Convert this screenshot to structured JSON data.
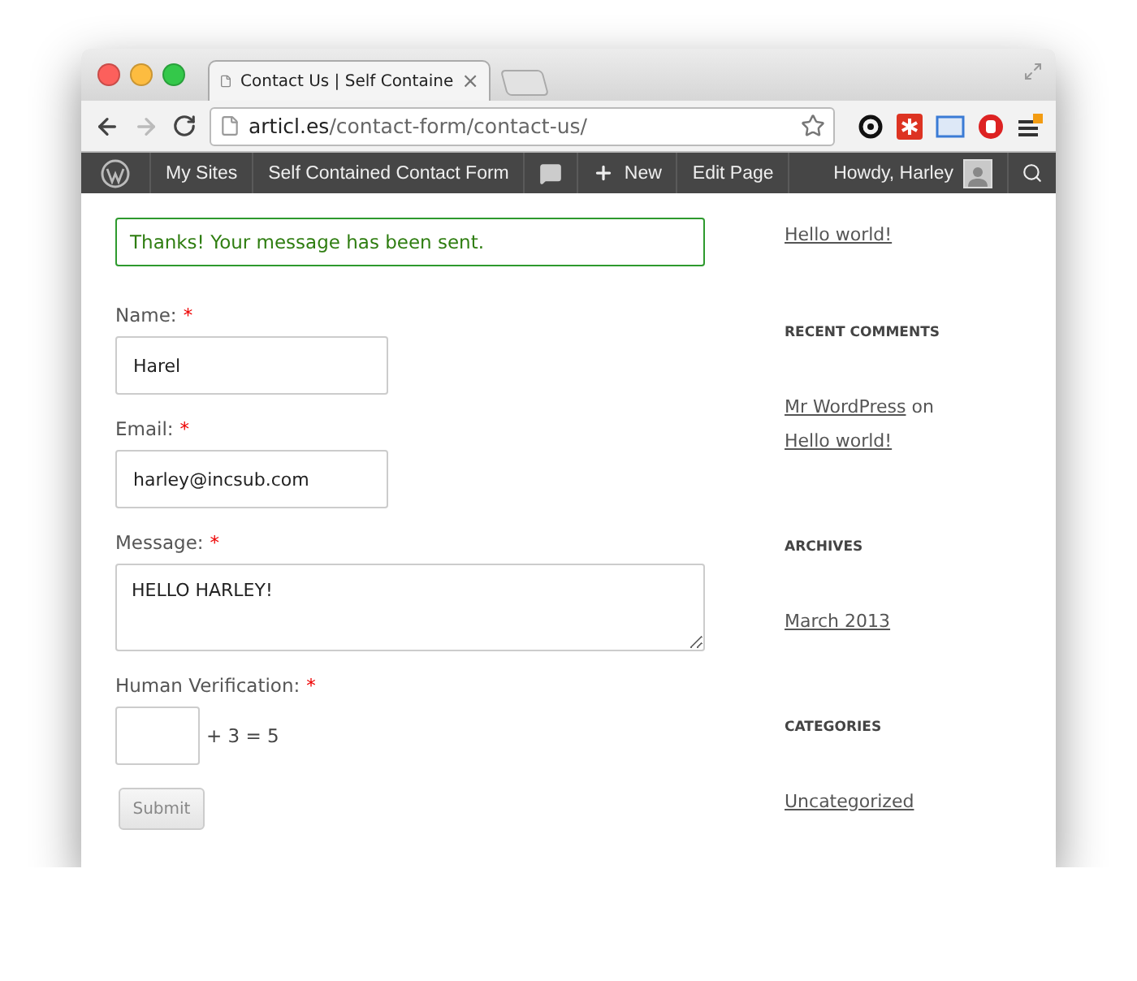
{
  "tab": {
    "title": "Contact Us | Self Containe",
    "close": "×"
  },
  "address": {
    "domain": "articl.es",
    "path": "/contact-form/contact-us/"
  },
  "admin_bar": [
    {
      "kind": "logo"
    },
    {
      "kind": "text",
      "label": "My Sites"
    },
    {
      "kind": "text",
      "label": "Self Contained Contact Form"
    },
    {
      "kind": "comments"
    },
    {
      "kind": "new",
      "label": "New"
    },
    {
      "kind": "text",
      "label": "Edit Page"
    },
    {
      "kind": "user",
      "label": "Howdy, Harley"
    },
    {
      "kind": "search"
    }
  ],
  "notice": "Thanks! Your message has been sent.",
  "fields": [
    {
      "kind": "text",
      "label": "Name:",
      "required_mark": "*",
      "value": "Harel"
    },
    {
      "kind": "text",
      "label": "Email:",
      "required_mark": "*",
      "value": "harley@incsub.com"
    },
    {
      "kind": "textarea",
      "label": "Message:",
      "required_mark": "*",
      "value": "HELLO HARLEY!"
    },
    {
      "kind": "captcha",
      "label": "Human Verification:",
      "required_mark": "*",
      "equation": "+ 3 = 5"
    }
  ],
  "submit": "Submit",
  "sidebar": {
    "recent_posts": [
      "Hello world!"
    ],
    "recent_comments": {
      "heading": "RECENT COMMENTS",
      "items": [
        {
          "author": "Mr WordPress",
          "on": "on",
          "post": "Hello world!"
        }
      ]
    },
    "archives": {
      "heading": "ARCHIVES",
      "items": [
        "March 2013"
      ]
    },
    "categories": {
      "heading": "CATEGORIES",
      "items": [
        "Uncategorized"
      ]
    }
  }
}
